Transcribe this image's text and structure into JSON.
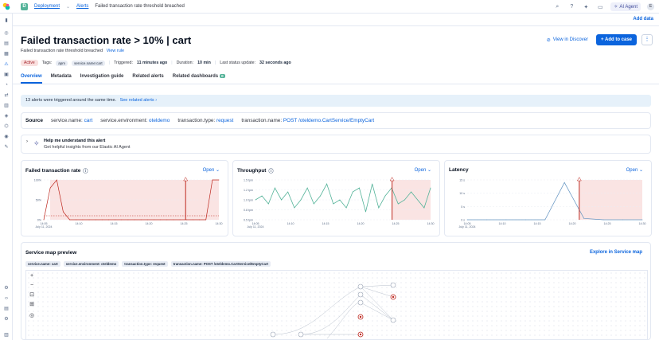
{
  "topbar": {
    "breadcrumbs": [
      "Deployment",
      "Alerts",
      "Failed transaction rate threshold breached"
    ],
    "ai_agent_label": "AI Agent",
    "avatar_initial": "E"
  },
  "subheader": {
    "add_data_label": "Add data"
  },
  "alert": {
    "title": "Failed transaction rate > 10% | cart",
    "subtitle": "Failed transaction rate threshold breached",
    "view_rule_label": "View rule",
    "status": "Active",
    "tags_label": "Tags:",
    "tags": [
      "apm",
      "service.name:cart"
    ],
    "triggered_label": "Triggered:",
    "triggered_value": "11 minutes ago",
    "duration_label": "Duration:",
    "duration_value": "10 min",
    "last_update_label": "Last status update:",
    "last_update_value": "32 seconds ago"
  },
  "actions": {
    "view_discover": "View in Discover",
    "add_to_case": "Add to case",
    "more": "⋮"
  },
  "tabs": [
    {
      "label": "Overview",
      "active": true
    },
    {
      "label": "Metadata"
    },
    {
      "label": "Investigation guide"
    },
    {
      "label": "Related alerts"
    },
    {
      "label": "Related dashboards",
      "count": "0"
    }
  ],
  "callout": {
    "text": "13 alerts were triggered around the same time.",
    "link": "See related alerts"
  },
  "source": {
    "label": "Source",
    "fields": [
      {
        "key": "service.name:",
        "value": "cart"
      },
      {
        "key": "service.environment:",
        "value": "oteldemo"
      },
      {
        "key": "transaction.type:",
        "value": "request"
      },
      {
        "key": "transaction.name:",
        "value": "POST /oteldemo.CartService/EmptyCart"
      }
    ]
  },
  "help": {
    "title": "Help me understand this alert",
    "subtitle": "Get helpful insights from our Elastic AI Agent"
  },
  "charts": {
    "open_label": "Open",
    "items": [
      {
        "title": "Failed transaction rate",
        "y_ticks": [
          "100%",
          "50%",
          "0%"
        ],
        "x_ticks": [
          "14:05\nJuly 11, 2024",
          "14:10",
          "14:15",
          "14:20",
          "14:25",
          "14:30"
        ]
      },
      {
        "title": "Throughput",
        "y_ticks": [
          "1.5 tpm",
          "1.2 tpm",
          "1.0 tpm",
          "0.8 tpm",
          "0.5 tpm"
        ],
        "x_ticks": [
          "14:05\nJuly 11, 2024",
          "14:10",
          "14:15",
          "14:20",
          "14:25",
          "14:30"
        ]
      },
      {
        "title": "Latency",
        "y_ticks": [
          "15 s",
          "10 s",
          "5 s",
          "0 s"
        ],
        "x_ticks": [
          "14:05\nJuly 11, 2024",
          "14:10",
          "14:15",
          "14:20",
          "14:25",
          "14:30"
        ]
      }
    ]
  },
  "chart_data": [
    {
      "type": "line",
      "title": "Failed transaction rate",
      "x": [
        "14:05",
        "14:06",
        "14:07",
        "14:08",
        "14:09",
        "14:10",
        "14:11",
        "14:12",
        "14:13",
        "14:14",
        "14:15",
        "14:16",
        "14:17",
        "14:18",
        "14:19",
        "14:20",
        "14:21",
        "14:22",
        "14:23",
        "14:24",
        "14:25",
        "14:26",
        "14:27",
        "14:28",
        "14:29",
        "14:30",
        "14:31",
        "14:32"
      ],
      "values": [
        0,
        80,
        100,
        20,
        0,
        0,
        0,
        0,
        0,
        0,
        0,
        0,
        0,
        0,
        0,
        0,
        0,
        0,
        0,
        0,
        0,
        0,
        0,
        0,
        0,
        0,
        100,
        100
      ],
      "ylim": [
        0,
        100
      ],
      "threshold": 10
    },
    {
      "type": "line",
      "title": "Throughput",
      "x": [
        "14:05",
        "14:06",
        "14:07",
        "14:08",
        "14:09",
        "14:10",
        "14:11",
        "14:12",
        "14:13",
        "14:14",
        "14:15",
        "14:16",
        "14:17",
        "14:18",
        "14:19",
        "14:20",
        "14:21",
        "14:22",
        "14:23",
        "14:24",
        "14:25",
        "14:26",
        "14:27",
        "14:28",
        "14:29",
        "14:30",
        "14:31",
        "14:32"
      ],
      "values": [
        1.0,
        1.1,
        0.9,
        1.3,
        1.0,
        1.2,
        0.8,
        1.0,
        1.3,
        0.9,
        1.1,
        1.4,
        0.9,
        1.0,
        0.8,
        1.2,
        1.3,
        0.7,
        1.4,
        0.8,
        1.1,
        1.3,
        0.9,
        1.0,
        1.2,
        1.0,
        0.8,
        1.3
      ],
      "ylim": [
        0.5,
        1.5
      ]
    },
    {
      "type": "line",
      "title": "Latency",
      "x": [
        "14:05",
        "14:10",
        "14:15",
        "14:20",
        "14:25",
        "14:26",
        "14:27",
        "14:28",
        "14:30",
        "14:32"
      ],
      "values": [
        0,
        0,
        0,
        0,
        0,
        14,
        0.5,
        0,
        0,
        0
      ],
      "ylim": [
        0,
        15
      ]
    }
  ],
  "service_map": {
    "title": "Service map preview",
    "explore_label": "Explore in Service map",
    "filters": [
      "service.name: cart",
      "service.environment: oteldemo",
      "transaction.type: request",
      "transaction.name: POST /oteldemo.CartService/EmptyCart"
    ],
    "zoom_controls": [
      "+",
      "−",
      "⊡",
      "⊞",
      "◎"
    ]
  },
  "colors": {
    "accent": "#0b64dd",
    "alert_red": "#bd271e",
    "series_teal": "#54b399"
  }
}
